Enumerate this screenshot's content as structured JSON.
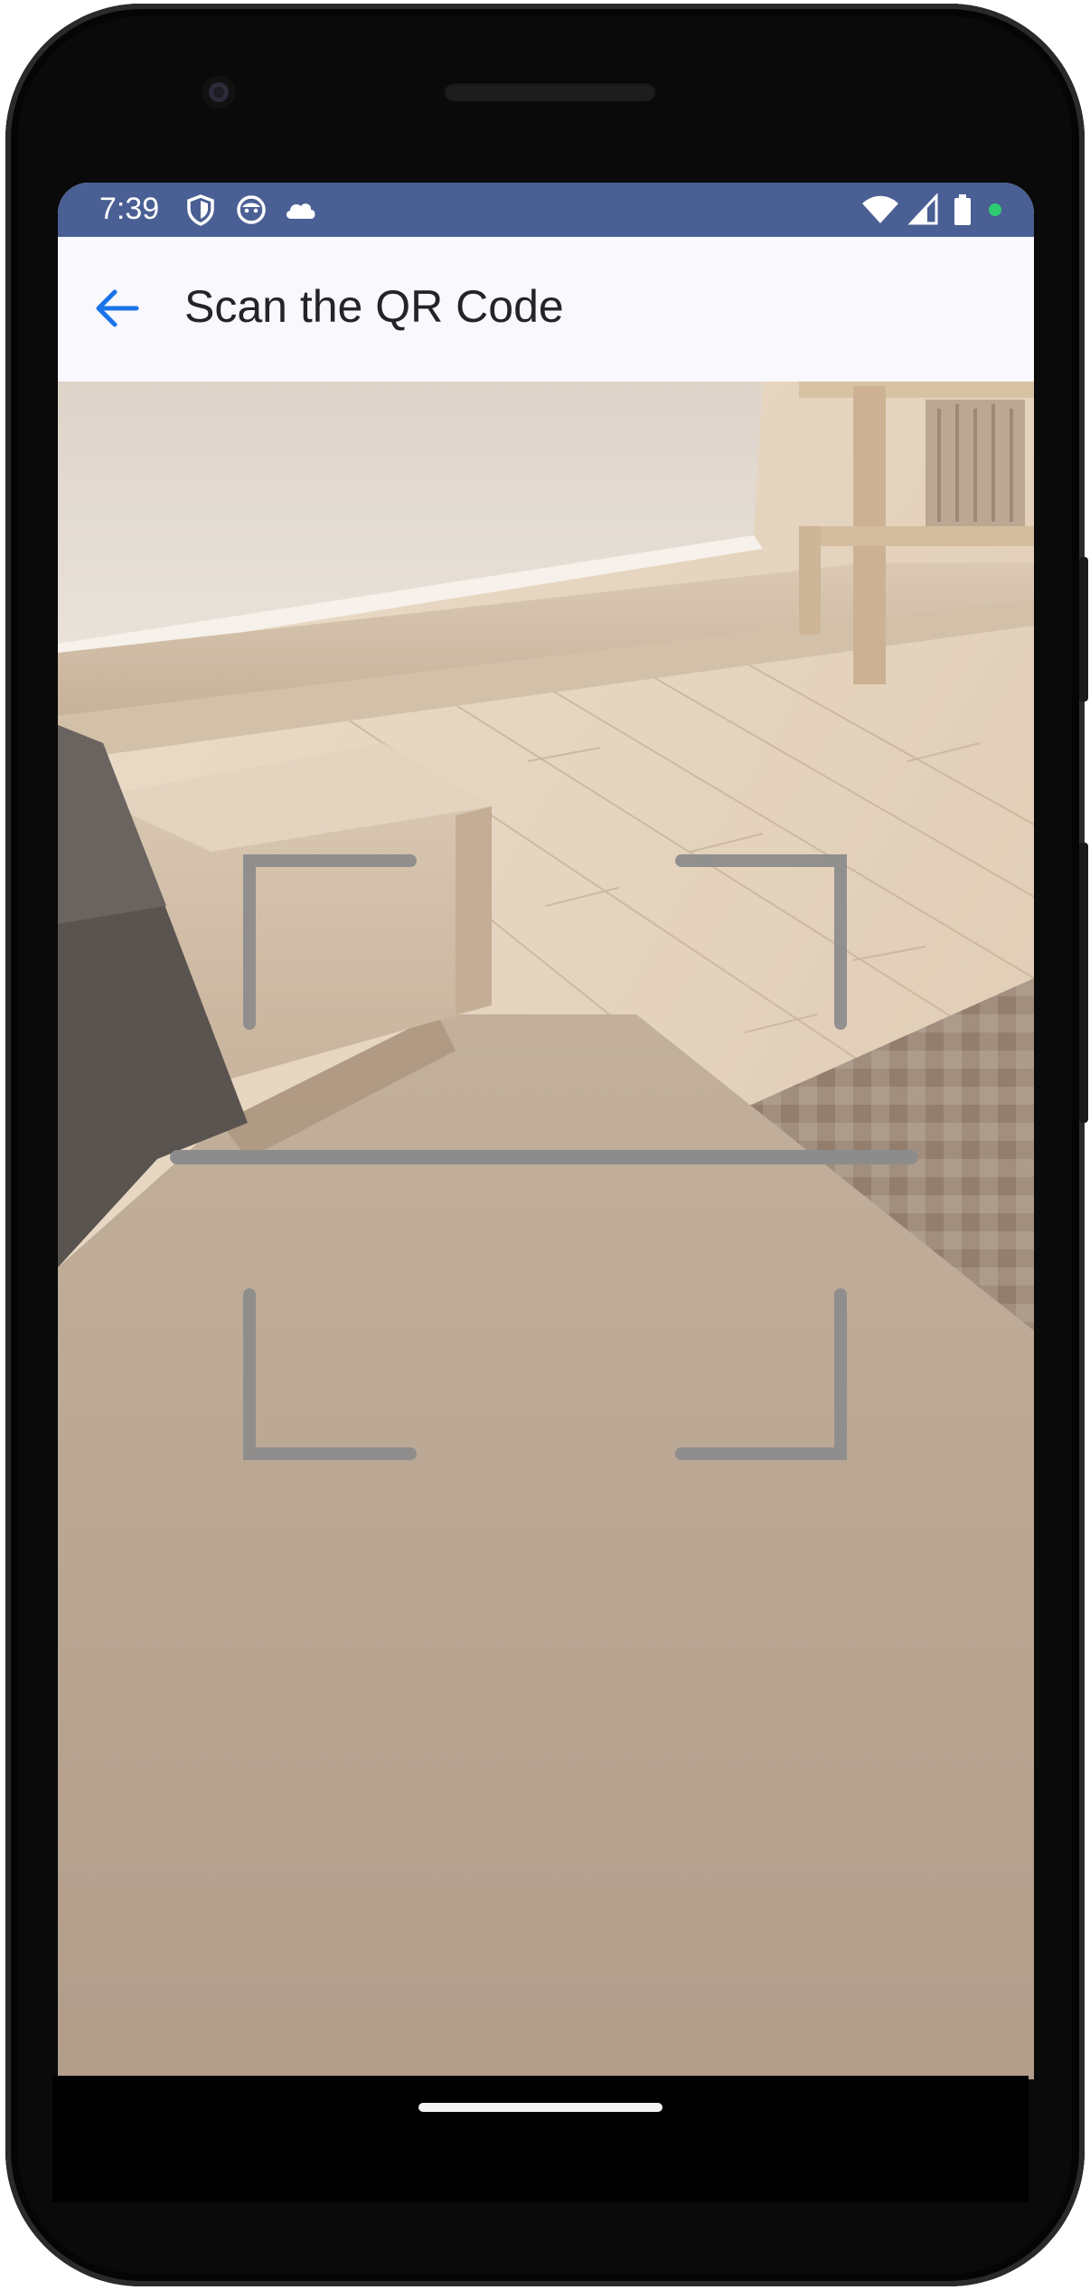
{
  "status_bar": {
    "time": "7:39",
    "left_icons": [
      "shield-icon",
      "face-icon",
      "cloud-icon"
    ],
    "right_icons": [
      "wifi-icon",
      "signal-icon",
      "battery-icon",
      "privacy-dot-icon"
    ],
    "background_color": "#4a5f93",
    "privacy_dot_color": "#2ecc71"
  },
  "app_bar": {
    "title": "Scan the QR Code",
    "back_icon": "arrow-left-icon",
    "accent_color": "#1a73e8"
  },
  "scanner": {
    "viewfinder_icon": "qr-viewfinder-icon",
    "scan_line_icon": "scan-line-icon",
    "overlay_color": "#8c8c8c"
  },
  "navigation": {
    "home_indicator": "home-indicator-icon"
  }
}
